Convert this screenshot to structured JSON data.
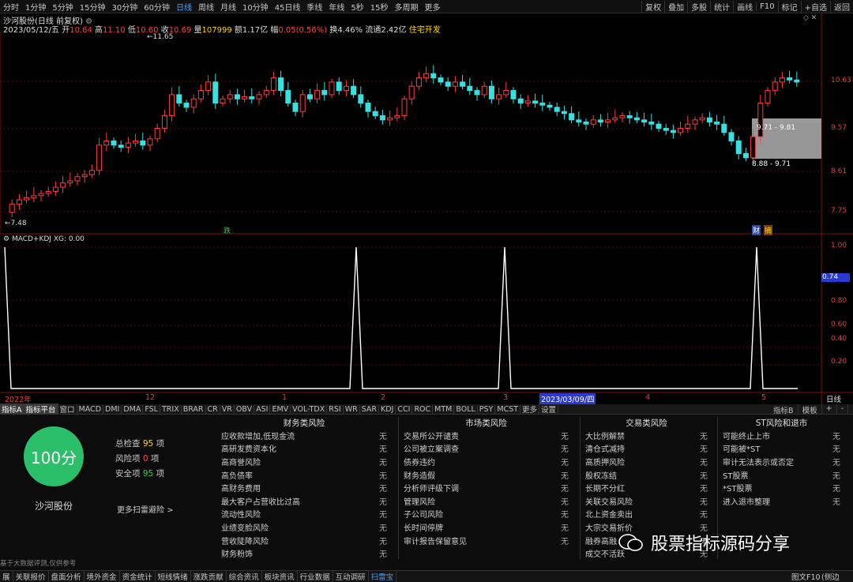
{
  "toolbar": {
    "left_items": [
      "分时",
      "1分钟",
      "5分钟",
      "15分钟",
      "30分钟",
      "60分钟",
      "日线",
      "周线",
      "月线",
      "10分钟",
      "45日线",
      "季线",
      "年线",
      "5秒",
      "15秒",
      "多周期",
      "更多"
    ],
    "active": "日线",
    "right_items": [
      "复权",
      "叠加",
      "多股",
      "统计",
      "画线",
      "F10",
      "标记",
      "+自选",
      "返回"
    ]
  },
  "stock": {
    "title": "沙河股份(日线 前复权)",
    "date": "2023/05/12/五",
    "open_label": "开",
    "open": "10.64",
    "high_label": "高",
    "high": "11.10",
    "low_label": "低",
    "low": "10.60",
    "close_label": "收",
    "close": "10.69",
    "vol_label": "量",
    "vol": "107999",
    "amt_label": "额",
    "amt": "1.17亿",
    "chg_label": "幅",
    "chg": "0.05(0.56%)",
    "turn_label": "换",
    "turn": "4.46%",
    "float_label": "流通",
    "float": "2.42亿",
    "concept": "住宅开发"
  },
  "price_axis": {
    "ticks": [
      "10.63",
      "9.57",
      "8.61",
      "7.75"
    ],
    "ylim": [
      7.3,
      11.9
    ],
    "high_mark": "11.65",
    "low_mark": "7.48"
  },
  "price_annotations": {
    "range1": "9.71 - 9.81",
    "range2": "8.88 - 9.71",
    "marks": [
      "跌",
      "财",
      "摘"
    ]
  },
  "indicator": {
    "title": "MACD+KDJ XG: 0.00",
    "axis_ticks": [
      "1.00",
      "0.80",
      "0.60",
      "0.40",
      "0.20"
    ],
    "current": "0.74"
  },
  "x_axis": {
    "labels": [
      "2022年",
      "12",
      "1",
      "2",
      "3",
      "2023/03/09/四",
      "4",
      "5"
    ],
    "corner": "日线"
  },
  "indicator_tabs": {
    "items": [
      "指标A",
      "指标平台",
      "窗口",
      "MACD",
      "DMI",
      "DMA",
      "FSL",
      "TRIX",
      "BRAR",
      "CR",
      "VR",
      "OBV",
      "ASI",
      "EMV",
      "VOL-TDX",
      "RSI",
      "WR",
      "SAR",
      "KDJ",
      "CCI",
      "ROC",
      "MTM",
      "BOLL",
      "PSY",
      "MCST",
      "更多",
      "设置"
    ],
    "right": [
      "指标B",
      "模板",
      "+",
      "-"
    ]
  },
  "risk": {
    "score": "100分",
    "stock_name": "沙河股份",
    "total_label": "总检查",
    "total": "95",
    "unit": "项",
    "risk_label": "风险项",
    "risk": "0",
    "safe_label": "安全项",
    "safe": "95",
    "more": "更多扫雷避险 >",
    "footnote": "基于大数据评测,仅供参考",
    "categories": [
      {
        "title": "财务类风险",
        "items": [
          "应收款增加,低现金流",
          "高研发费资本化",
          "高商誉风险",
          "高负债率",
          "高财务费用",
          "最大客户占营收比过高",
          "流动性风险",
          "业绩变脸风险",
          "营收陡降风险",
          "财务粉饰"
        ]
      },
      {
        "title": "市场类风险",
        "items": [
          "交易所公开谴责",
          "公司被立案调查",
          "债券违约",
          "财务造假",
          "分析师评级下调",
          "管理风险",
          "子公司风险",
          "长时间停牌",
          "审计报告保留意见"
        ]
      },
      {
        "title": "交易类风险",
        "items": [
          "大比例解禁",
          "清仓式减持",
          "高质押风险",
          "股权冻结",
          "长期不分红",
          "关联交易风险",
          "北上资金卖出",
          "大宗交易折价",
          "融券高融",
          "成交不活跃"
        ]
      },
      {
        "title": "ST风险和退市",
        "items": [
          "可能终止上市",
          "可能被*ST",
          "审计无法表示或否定",
          "ST股票",
          "*ST股票",
          "进入退市整理"
        ]
      }
    ],
    "none_label": "无"
  },
  "bottom_tabs": {
    "items": [
      "展",
      "关联报价",
      "盘面分析",
      "境外资金",
      "资金统计",
      "短线情绪",
      "涨跌贡献",
      "综合资讯",
      "板块资讯",
      "行业数据",
      "互动调研",
      "扫雷宝"
    ],
    "selected": "扫雷宝",
    "right": "图文F10",
    "corner": "侧边栏"
  },
  "watermark": "股票指标源码分享",
  "colors": {
    "up": "#ff3c3c",
    "down": "#38e0e0",
    "bg": "#000000",
    "score": "#2bbf6a"
  }
}
